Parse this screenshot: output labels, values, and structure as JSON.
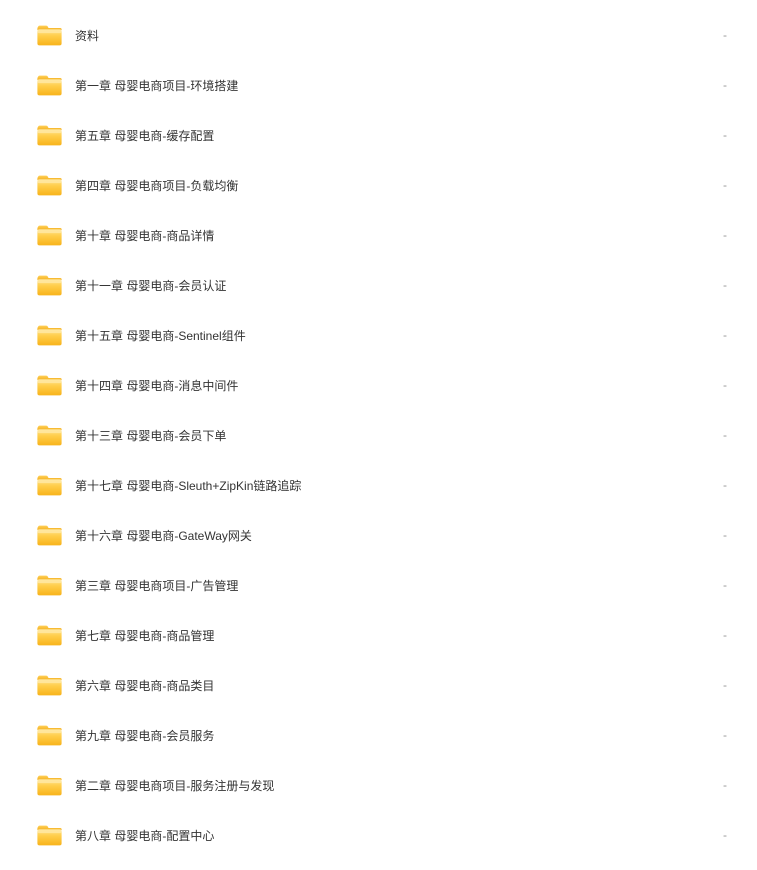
{
  "folders": [
    {
      "name": "资料",
      "size": "-"
    },
    {
      "name": "第一章 母婴电商项目-环境搭建",
      "size": "-"
    },
    {
      "name": "第五章 母婴电商-缓存配置",
      "size": "-"
    },
    {
      "name": "第四章 母婴电商项目-负载均衡",
      "size": "-"
    },
    {
      "name": "第十章 母婴电商-商品详情",
      "size": "-"
    },
    {
      "name": "第十一章 母婴电商-会员认证",
      "size": "-"
    },
    {
      "name": "第十五章 母婴电商-Sentinel组件",
      "size": "-"
    },
    {
      "name": "第十四章 母婴电商-消息中间件",
      "size": "-"
    },
    {
      "name": "第十三章 母婴电商-会员下单",
      "size": "-"
    },
    {
      "name": "第十七章 母婴电商-Sleuth+ZipKin链路追踪",
      "size": "-"
    },
    {
      "name": "第十六章 母婴电商-GateWay网关",
      "size": "-"
    },
    {
      "name": "第三章 母婴电商项目-广告管理",
      "size": "-"
    },
    {
      "name": "第七章 母婴电商-商品管理",
      "size": "-"
    },
    {
      "name": "第六章 母婴电商-商品类目",
      "size": "-"
    },
    {
      "name": "第九章 母婴电商-会员服务",
      "size": "-"
    },
    {
      "name": "第二章 母婴电商项目-服务注册与发现",
      "size": "-"
    },
    {
      "name": "第八章 母婴电商-配置中心",
      "size": "-"
    }
  ],
  "icon_color": {
    "folder_main": "#FFC843",
    "folder_tab": "#F5B829",
    "folder_highlight": "#FFDC7E"
  }
}
